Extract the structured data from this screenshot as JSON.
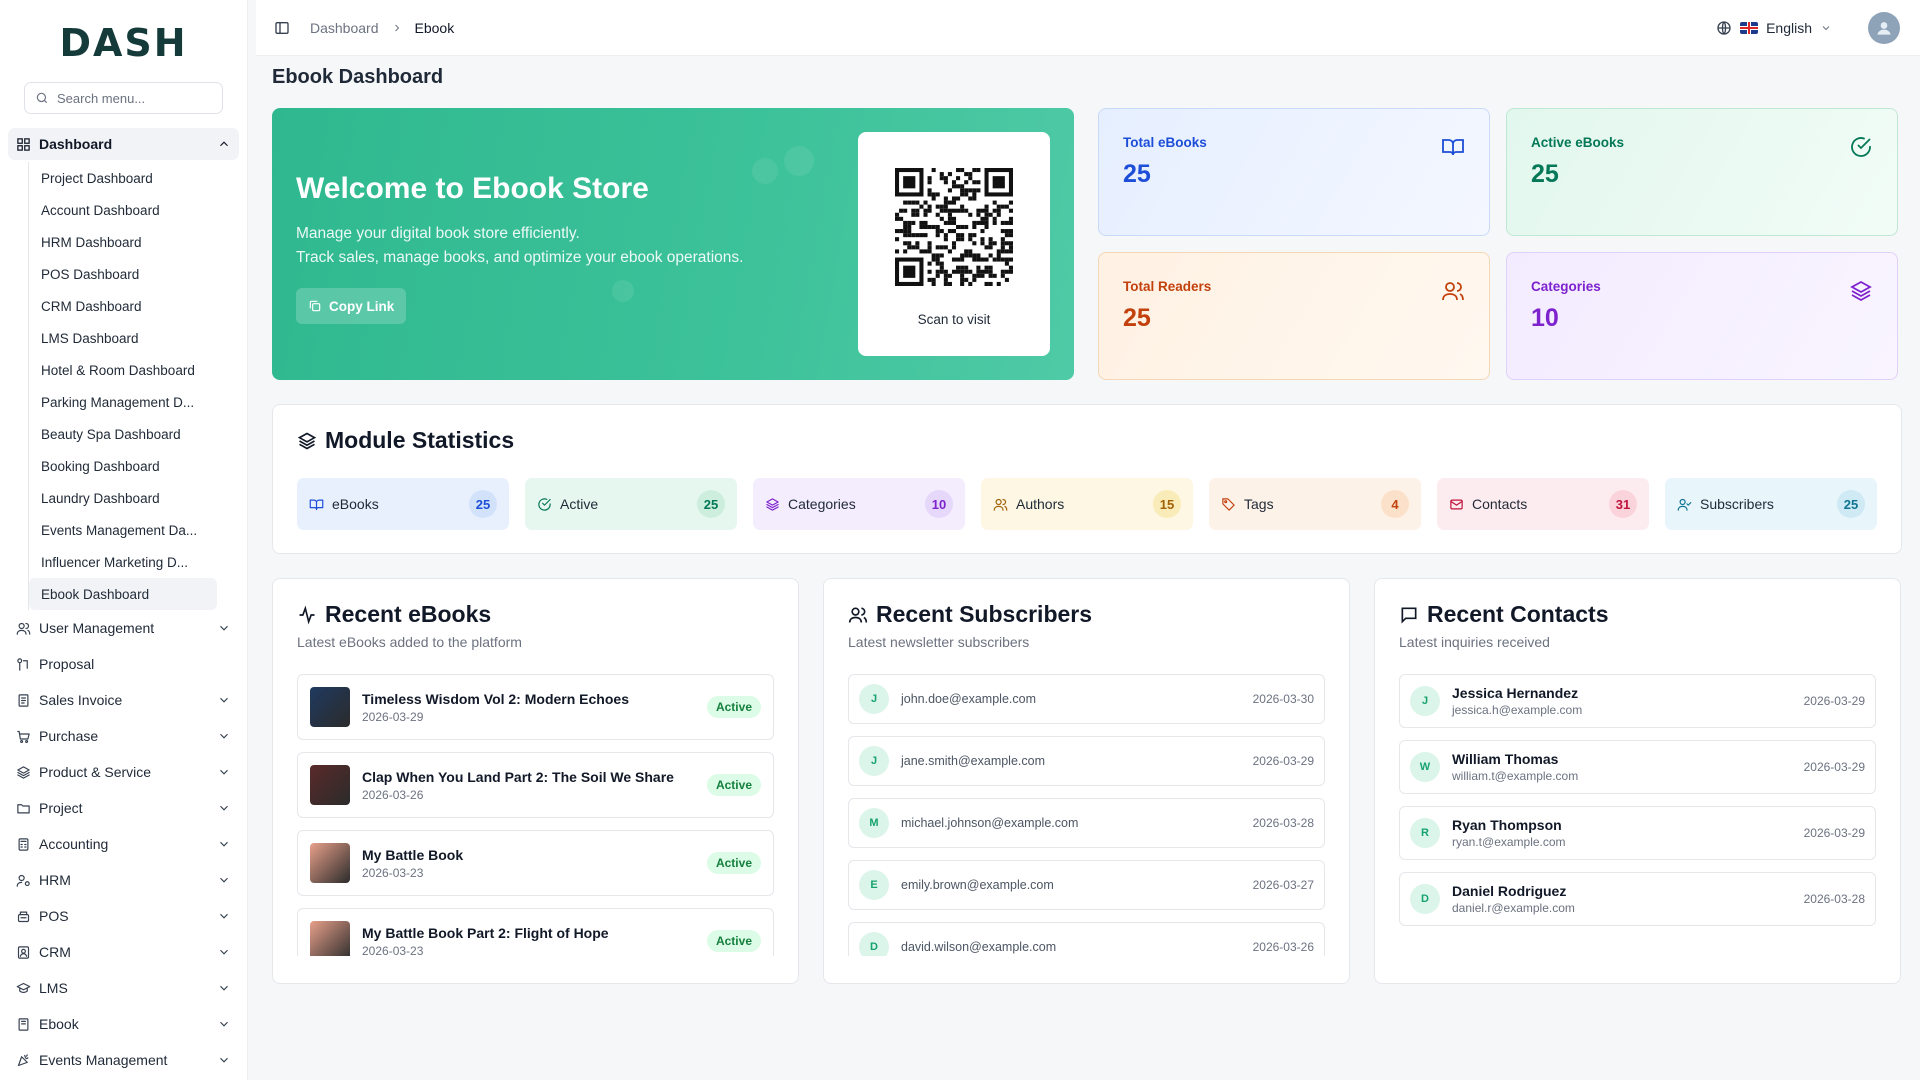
{
  "brand": {
    "logo_text": "DASH"
  },
  "search": {
    "placeholder": "Search menu..."
  },
  "sidebar": {
    "active_group": "Dashboard",
    "dashboards": [
      "Project Dashboard",
      "Account Dashboard",
      "HRM Dashboard",
      "POS Dashboard",
      "CRM Dashboard",
      "LMS Dashboard",
      "Hotel & Room Dashboard",
      "Parking Management D...",
      "Beauty Spa Dashboard",
      "Booking Dashboard",
      "Laundry Dashboard",
      "Events Management Da...",
      "Influencer Marketing D...",
      "Ebook Dashboard"
    ],
    "modules": [
      {
        "label": "User Management",
        "icon": "users-icon",
        "has_children": true
      },
      {
        "label": "Proposal",
        "icon": "proposal-icon",
        "has_children": false
      },
      {
        "label": "Sales Invoice",
        "icon": "invoice-icon",
        "has_children": true
      },
      {
        "label": "Purchase",
        "icon": "cart-icon",
        "has_children": true
      },
      {
        "label": "Product & Service",
        "icon": "layers-icon",
        "has_children": true
      },
      {
        "label": "Project",
        "icon": "folder-icon",
        "has_children": true
      },
      {
        "label": "Accounting",
        "icon": "calculator-icon",
        "has_children": true
      },
      {
        "label": "HRM",
        "icon": "hrm-icon",
        "has_children": true
      },
      {
        "label": "POS",
        "icon": "register-icon",
        "has_children": true
      },
      {
        "label": "CRM",
        "icon": "crm-icon",
        "has_children": true
      },
      {
        "label": "LMS",
        "icon": "graduation-icon",
        "has_children": true
      },
      {
        "label": "Ebook",
        "icon": "book-icon",
        "has_children": true
      },
      {
        "label": "Events Management",
        "icon": "party-icon",
        "has_children": true
      }
    ]
  },
  "header": {
    "breadcrumb": [
      "Dashboard",
      "Ebook"
    ],
    "language": "English"
  },
  "page": {
    "title": "Ebook Dashboard"
  },
  "welcome": {
    "title": "Welcome to Ebook Store",
    "line1": "Manage your digital book store efficiently.",
    "line2": "Track sales, manage books, and optimize your ebook operations.",
    "copy_label": "Copy Link",
    "qr_label": "Scan to visit"
  },
  "stats": [
    {
      "label": "Total eBooks",
      "value": "25",
      "icon": "book-open-icon"
    },
    {
      "label": "Active eBooks",
      "value": "25",
      "icon": "check-circle-icon"
    },
    {
      "label": "Total Readers",
      "value": "25",
      "icon": "users-icon"
    },
    {
      "label": "Categories",
      "value": "10",
      "icon": "layers-icon"
    }
  ],
  "module_stats": {
    "title": "Module Statistics",
    "items": [
      {
        "label": "eBooks",
        "count": "25",
        "icon": "book-open-icon",
        "bg": "#e8f0fd",
        "fg": "#1d4ed8",
        "badge": "#d3e2fb"
      },
      {
        "label": "Active",
        "count": "25",
        "icon": "check-circle-icon",
        "bg": "#e6f7ef",
        "fg": "#047857",
        "badge": "#cdeedd"
      },
      {
        "label": "Categories",
        "count": "10",
        "icon": "layers-icon",
        "bg": "#f4edfd",
        "fg": "#7e22ce",
        "badge": "#e6d8fa"
      },
      {
        "label": "Authors",
        "count": "15",
        "icon": "users-icon",
        "bg": "#fdf7e3",
        "fg": "#a16207",
        "badge": "#f9ecb8"
      },
      {
        "label": "Tags",
        "count": "4",
        "icon": "tag-icon",
        "bg": "#fdf2e8",
        "fg": "#c2410c",
        "badge": "#fbe1c9"
      },
      {
        "label": "Contacts",
        "count": "31",
        "icon": "mail-icon",
        "bg": "#fdecef",
        "fg": "#be123c",
        "badge": "#fbd3db"
      },
      {
        "label": "Subscribers",
        "count": "25",
        "icon": "user-check-icon",
        "bg": "#e8f5fb",
        "fg": "#0e7490",
        "badge": "#cfeaf5"
      }
    ]
  },
  "recent_ebooks": {
    "title": "Recent eBooks",
    "subtitle": "Latest eBooks added to the platform",
    "items": [
      {
        "title": "Timeless Wisdom Vol 2: Modern Echoes",
        "date": "2026-03-29",
        "status": "Active",
        "cover": "#1f3a5f"
      },
      {
        "title": "Clap When You Land Part 2: The Soil We Share",
        "date": "2026-03-26",
        "status": "Active",
        "cover": "#5a2a2a"
      },
      {
        "title": "My Battle Book",
        "date": "2026-03-23",
        "status": "Active",
        "cover": "#e8a08a"
      },
      {
        "title": "My Battle Book Part 2: Flight of Hope",
        "date": "2026-03-23",
        "status": "Active",
        "cover": "#e8a08a"
      }
    ]
  },
  "recent_subscribers": {
    "title": "Recent Subscribers",
    "subtitle": "Latest newsletter subscribers",
    "items": [
      {
        "initial": "J",
        "email": "john.doe@example.com",
        "date": "2026-03-30"
      },
      {
        "initial": "J",
        "email": "jane.smith@example.com",
        "date": "2026-03-29"
      },
      {
        "initial": "M",
        "email": "michael.johnson@example.com",
        "date": "2026-03-28"
      },
      {
        "initial": "E",
        "email": "emily.brown@example.com",
        "date": "2026-03-27"
      },
      {
        "initial": "D",
        "email": "david.wilson@example.com",
        "date": "2026-03-26"
      }
    ]
  },
  "recent_contacts": {
    "title": "Recent Contacts",
    "subtitle": "Latest inquiries received",
    "items": [
      {
        "initial": "J",
        "name": "Jessica Hernandez",
        "email": "jessica.h@example.com",
        "date": "2026-03-29"
      },
      {
        "initial": "W",
        "name": "William Thomas",
        "email": "william.t@example.com",
        "date": "2026-03-29"
      },
      {
        "initial": "R",
        "name": "Ryan Thompson",
        "email": "ryan.t@example.com",
        "date": "2026-03-29"
      },
      {
        "initial": "D",
        "name": "Daniel Rodriguez",
        "email": "daniel.r@example.com",
        "date": "2026-03-28"
      }
    ]
  }
}
